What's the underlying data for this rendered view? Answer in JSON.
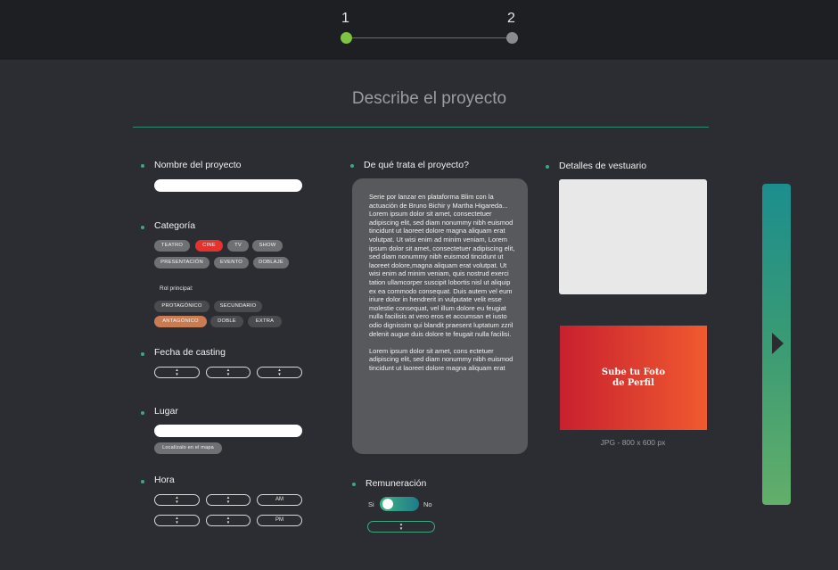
{
  "stepper": {
    "steps": [
      {
        "label": "1",
        "color": "#7dc443"
      },
      {
        "label": "2",
        "color": "#8a8b8f"
      }
    ]
  },
  "page_title": "Describe el proyecto",
  "project_name": {
    "label": "Nombre del proyecto",
    "value": ""
  },
  "category": {
    "label": "Categoría",
    "options": [
      "TEATRO",
      "CINE",
      "TV",
      "SHOW",
      "PRESENTACIÓN",
      "EVENTO",
      "DOBLAJE"
    ],
    "selected": "CINE"
  },
  "role": {
    "label": "Rol principal:",
    "options": [
      "PROTAGÓNICO",
      "SECUNDARIO",
      "ANTAGÓNICO",
      "DOBLE",
      "EXTRA"
    ],
    "selected": "ANTAGÓNICO"
  },
  "casting_date": {
    "label": "Fecha de casting"
  },
  "location": {
    "label": "Lugar",
    "value": "",
    "map_button": "Localízalo en el mapa"
  },
  "time": {
    "label": "Hora",
    "am": "AM",
    "pm": "PM"
  },
  "description": {
    "label": "De qué trata el proyecto?",
    "paragraph1": "Serie por lanzar en plataforma Blim con la actuación de Bruno Bichir y Martha Higareda... Lorem ipsum dolor sit amet, consectetuer adipiscing elit, sed diam nonummy nibh euismod tincidunt ut laoreet dolore magna aliquam erat volutpat. Ut wisi enim ad minim veniam, Lorem ipsum dolor sit amet, consectetuer adipiscing elit, sed diam nonummy nibh euismod tincidunt ut laoreet dolore,magna aliquam erat volutpat. Ut wisi enim ad minim veniam, quis nostrud exerci tation ullamcorper suscipit lobortis nisl ut aliquip ex ea commodo consequat. Duis autem vel eum iriure dolor in hendrerit in vulputate velit esse molestie consequat, vel illum dolore eu feugiat nulla facilisis at vero eros et accumsan et iusto odio dignissim qui blandit praesent luptatum zzril delenit augue duis dolore te feugait nulla facilisi.",
    "paragraph2": "Lorem ipsum dolor sit amet, cons ectetuer adipiscing elit, sed diam nonummy nibh euismod tincidunt ut laoreet dolore magna aliquam erat"
  },
  "remuneration": {
    "label": "Remuneración",
    "yes": "Si",
    "no": "No",
    "enabled": true
  },
  "wardrobe": {
    "label": "Detalles de vestuario"
  },
  "profile_photo": {
    "line1": "Sube tu Foto",
    "line2": "de Perfil",
    "hint": "JPG - 800 x 600 px"
  },
  "colors": {
    "accent": "#3ea87c",
    "selected_category": "#e5322e",
    "selected_role": "#c97b52"
  },
  "icons": {
    "next": "play-triangle-icon",
    "spinner": "up-down-arrows-icon"
  }
}
